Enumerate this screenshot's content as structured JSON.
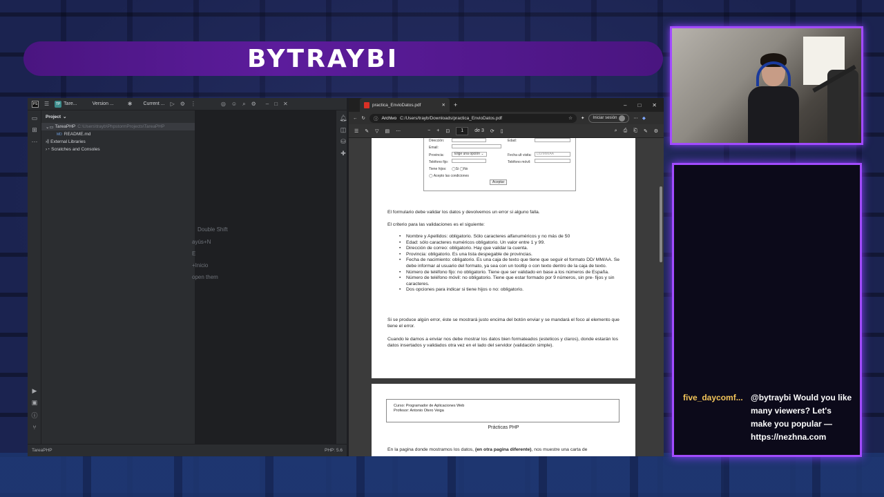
{
  "banner": {
    "title": "BYTRAYBI"
  },
  "chat": {
    "username": "five_daycomf...",
    "message": "@bytraybi Would you like many viewers? Let's make you popular — https://nezhna.com"
  },
  "ide": {
    "project_tab": "Tare...",
    "vcs_widget": "Version ...",
    "run_config": "Current ...",
    "panel_title": "Project",
    "tree": [
      {
        "label": "TareaPHP",
        "path": "C:\\Users\\trayb\\PhpstormProjects\\TareaPHP"
      },
      {
        "label": "README.md"
      },
      {
        "label": "External Libraries"
      },
      {
        "label": "Scratches and Consoles"
      }
    ],
    "hints": [
      "Double Shift",
      "ayús+N",
      "E",
      "+Inicio",
      "open them"
    ],
    "status_left": "TareaPHP",
    "status_right": "PHP: 5.6"
  },
  "browser": {
    "tab_title": "practica_EnvioDatos.pdf",
    "file_chip": "Archivo",
    "url": "C:/Users/trayb/Downloads/practica_EnvioDatos.pdf",
    "signin_label": "Iniciar sesión",
    "page_current": "1",
    "page_total": "de 3"
  },
  "pdf": {
    "form": {
      "direccion": "Dirección:",
      "edad": "Edad:",
      "email": "Email:",
      "provincia": "Provincia:",
      "provincia_select": "Elige una opción",
      "fecha": "Fecha ult visita:",
      "fecha_placeholder": "DD/MM/AA",
      "telefono_fijo": "Teléfono fijo:",
      "telefono_movil": "Teléfono móvil:",
      "tiene_hijos": "Tiene hijos:",
      "si": "Si",
      "no": "No",
      "acepto": "Acepto las condiciones",
      "aceptar": "Aceptar"
    },
    "para1": "El formulario debe validar los datos y devolvemos un error si alguno falla.",
    "para2": "El criterio para las validaciones es el siguiente:",
    "bullets": [
      "Nombre y Apellidos: obligatorio. Sólo caracteres alfanuméricos y no más de 50",
      "Edad: sólo caracteres numéricos obligatorio. Un valor entre 1 y 99.",
      "Dirección de correo: obligatorio. Hay que validar la cuenta.",
      "Provincia: obligatorio. Es una lista despegable de provincias.",
      "Fecha de nacimiento: obligatorio. Es una caja de texto que tiene que seguir el formato DD/ MM/AA. Se debe informar al usuario del formato, ya sea con un tooltip o con texto dentro de la caja de texto.",
      "Número de teléfono fijo: no obligatorio. Tiene que ser validado en base a los números de España.",
      "Número de teléfono móvil: no obligatorio. Tiene que estar  formado por 9 números, sin pre- fijos y sin caracteres.",
      "Dos opciones para indicar si tiene hijos o no: obligatorio."
    ],
    "para3": "Si se produce algún error, éste se mostrará justo encima del botón enviar y se mandará el foco al elemento que tiene el error.",
    "para4": "Cuando le damos a enviar nos debe mostrar los datos bien formateados (esteticos y claros), donde estarán los datos insertados y validados otra vez en el lado del servidor (validación simple).",
    "course_line1": "Curso: Programador de Aplicaciones Web",
    "course_line2": "Profesor: Antonio Otero Veiga",
    "course_title": "Prácticas PHP",
    "page2_text_start": "En la pagina donde mostramos los datos,",
    "page2_text_bold": "(en otra pagina diferente)",
    "page2_text_end": ", nos muestre una carta de"
  }
}
